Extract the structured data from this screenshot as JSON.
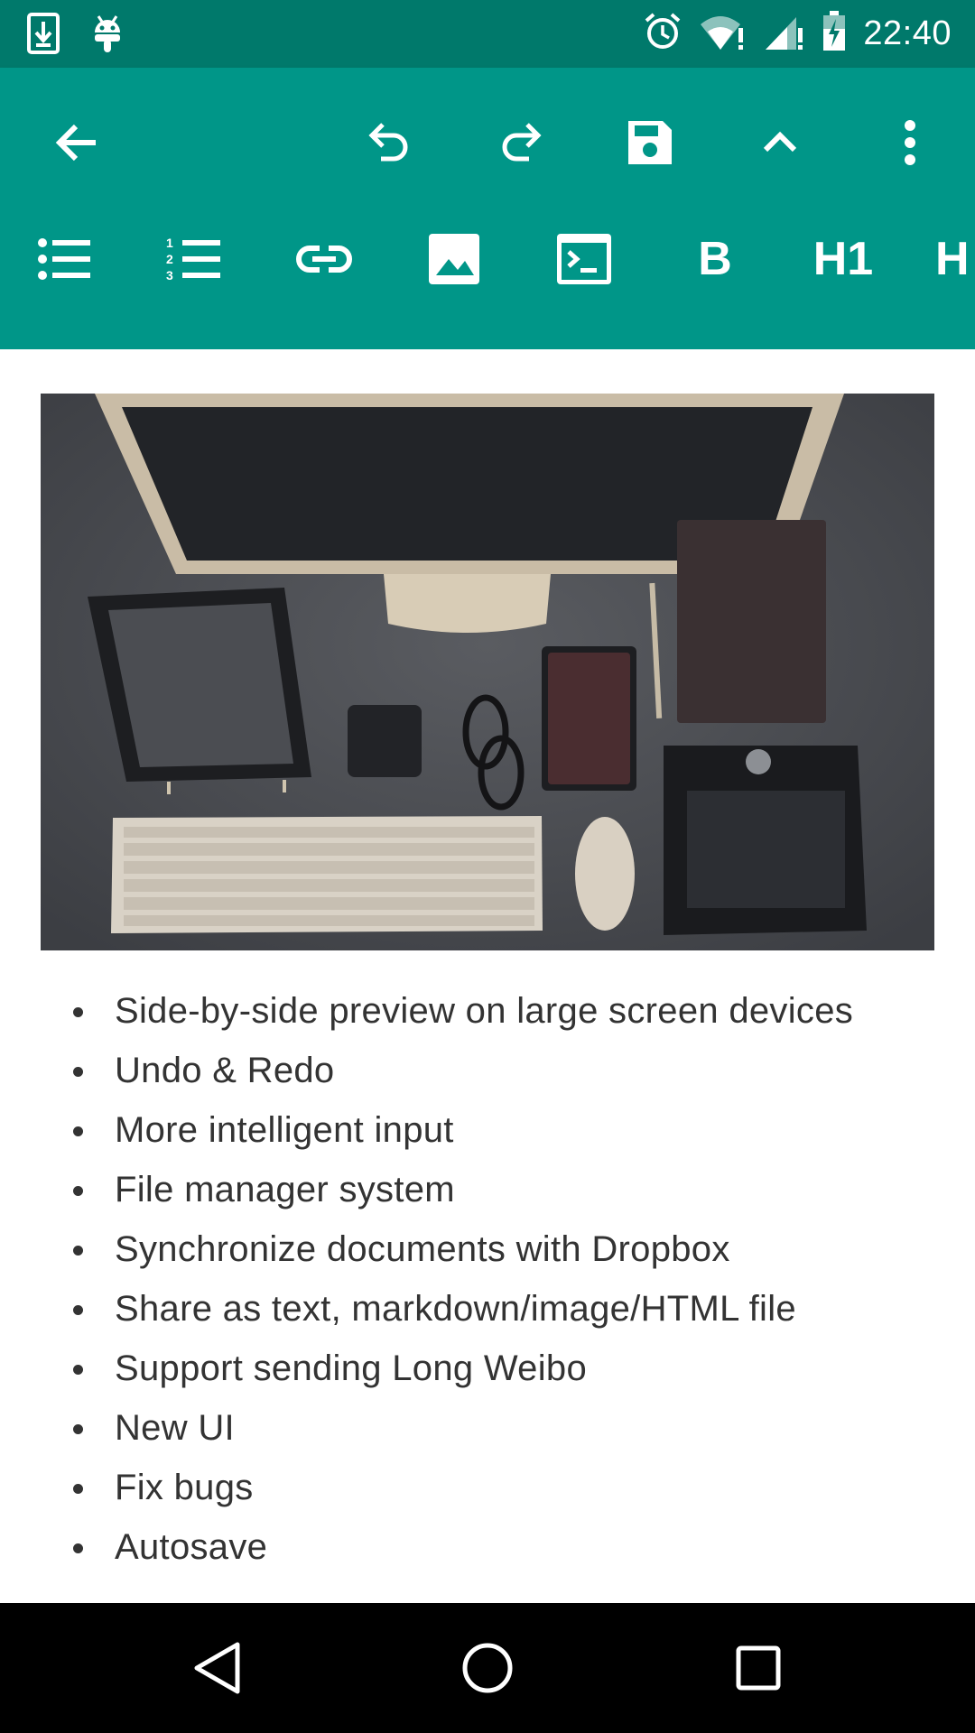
{
  "status_bar": {
    "time": "22:40",
    "left_icons": [
      "download-icon",
      "android-icon"
    ],
    "right_icons": [
      "alarm-icon",
      "wifi-icon",
      "signal-icon",
      "battery-charging-icon"
    ]
  },
  "toolbar": {
    "background": "#009688",
    "actions": [
      "back-arrow-icon",
      "undo-icon",
      "redo-icon",
      "save-icon",
      "collapse-up-icon",
      "more-vert-icon"
    ],
    "format": {
      "items": [
        "bulleted-list-icon",
        "numbered-list-icon",
        "link-icon",
        "image-icon",
        "code-icon"
      ],
      "bold_label": "B",
      "h1_label": "H1",
      "h2_label": "H"
    }
  },
  "content": {
    "image": "desk-workspace-photo",
    "features": [
      "Side-by-side preview on large screen devices",
      "Undo & Redo",
      "More intelligent input",
      "File manager system",
      "Synchronize documents with Dropbox",
      "Share as text, markdown/image/HTML file",
      "Support sending Long Weibo",
      "New UI",
      "Fix bugs",
      "Autosave"
    ]
  },
  "nav_bar": {
    "buttons": [
      "back-triangle-icon",
      "home-circle-icon",
      "recents-square-icon"
    ]
  }
}
